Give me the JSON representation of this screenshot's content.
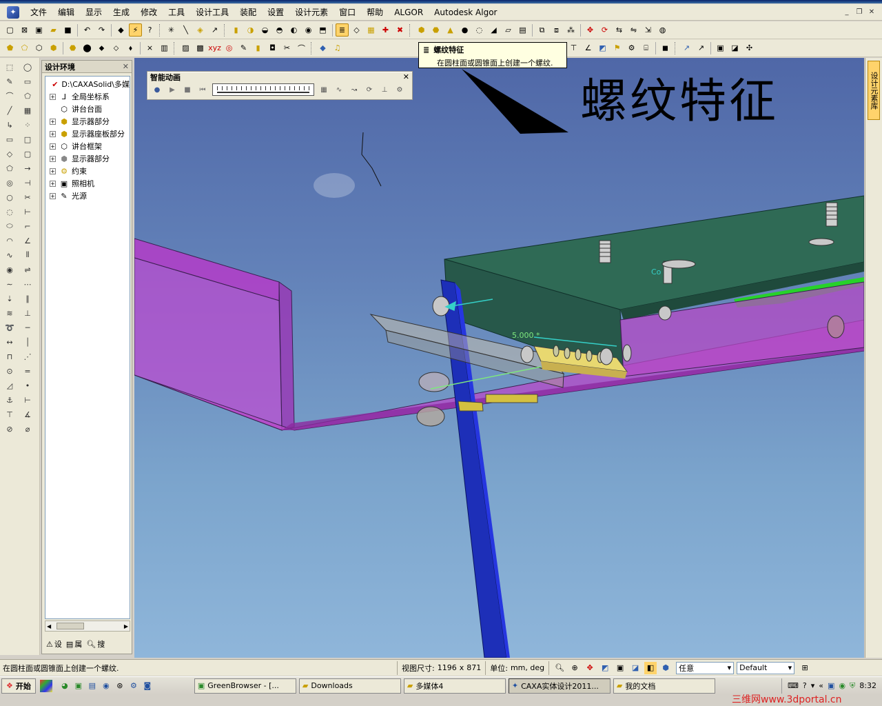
{
  "menu": {
    "items": [
      "文件",
      "编辑",
      "显示",
      "生成",
      "修改",
      "工具",
      "设计工具",
      "装配",
      "设置",
      "设计元素",
      "窗口",
      "帮助",
      "ALGOR",
      "Autodesk Algor"
    ]
  },
  "tooltip": {
    "title": "螺纹特征",
    "body": "在圆柱面或圆锥面上创建一个螺纹."
  },
  "annotation": {
    "label": "螺纹特征"
  },
  "animation_bar": {
    "title": "智能动画"
  },
  "design_panel": {
    "title": "设计环境",
    "tree": [
      {
        "label": "D:\\CAXASolid\\多媒",
        "icon": "design-root-icon",
        "expandable": false
      },
      {
        "label": "全局坐标系",
        "icon": "axis-icon",
        "expandable": true
      },
      {
        "label": "讲台台面",
        "icon": "part-icon",
        "expandable": false
      },
      {
        "label": "显示器部分",
        "icon": "assembly-icon",
        "expandable": true
      },
      {
        "label": "显示器座板部分",
        "icon": "assembly-icon",
        "expandable": true
      },
      {
        "label": "讲台框架",
        "icon": "part-icon",
        "expandable": true
      },
      {
        "label": "显示器部分",
        "icon": "assembly-icon",
        "expandable": true
      },
      {
        "label": "约束",
        "icon": "constraint-icon",
        "expandable": true
      },
      {
        "label": "照相机",
        "icon": "camera-icon",
        "expandable": true
      },
      {
        "label": "光源",
        "icon": "light-icon",
        "expandable": true
      }
    ],
    "tabs": [
      "设",
      "属",
      "搜"
    ]
  },
  "right_dock": {
    "tab": "设计元素库"
  },
  "viewport": {
    "dimension_label": "5.000 *",
    "part_label": "Co"
  },
  "statusbar": {
    "message": "在圆柱面或圆锥面上创建一个螺纹.",
    "view_size_label": "视图尺寸:",
    "view_width": "1196",
    "view_x": "x",
    "view_height": "871",
    "units_label": "单位:",
    "units_value": "mm, deg",
    "combo1": "任意",
    "combo2": "Default"
  },
  "taskbar": {
    "start": "开始",
    "tasks": [
      {
        "label": "GreenBrowser - [...",
        "active": false
      },
      {
        "label": "Downloads",
        "active": false
      },
      {
        "label": "多媒体4",
        "active": false
      },
      {
        "label": "CAXA实体设计2011...",
        "active": true
      },
      {
        "label": "我的文档",
        "active": false
      }
    ],
    "clock": "8:32"
  },
  "watermark": "三维网www.3dportal.cn",
  "colors": {
    "viewport_top": "#4f67a7",
    "viewport_bottom": "#8fb6da",
    "tooltip_bg": "#ffffe1",
    "dock_tab": "#ffd36b"
  }
}
